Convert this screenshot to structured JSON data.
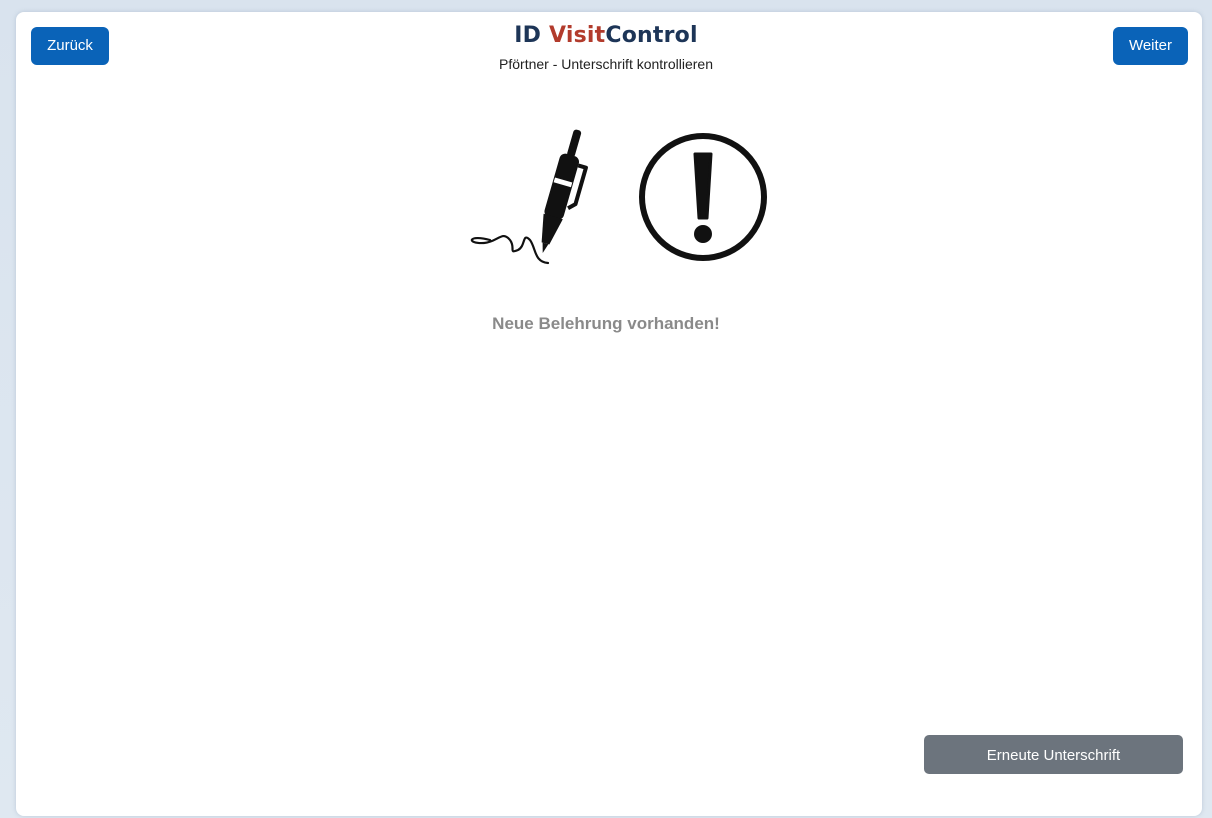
{
  "header": {
    "logo_id": "ID",
    "logo_visit": "Visit",
    "logo_control": "Control",
    "subtitle": "Pförtner - Unterschrift kontrollieren"
  },
  "nav": {
    "back_label": "Zurück",
    "next_label": "Weiter"
  },
  "main": {
    "illustration_icons": [
      "pen-signature-icon",
      "exclamation-circle-icon"
    ],
    "notice": "Neue Belehrung vorhanden!"
  },
  "footer": {
    "resign_label": "Erneute Unterschrift"
  },
  "colors": {
    "primary_button": "#0a63b8",
    "secondary_button": "#6c747d",
    "logo_dark": "#1d3557",
    "logo_accent": "#b23b2c",
    "notice_text": "#8a8a8a"
  }
}
